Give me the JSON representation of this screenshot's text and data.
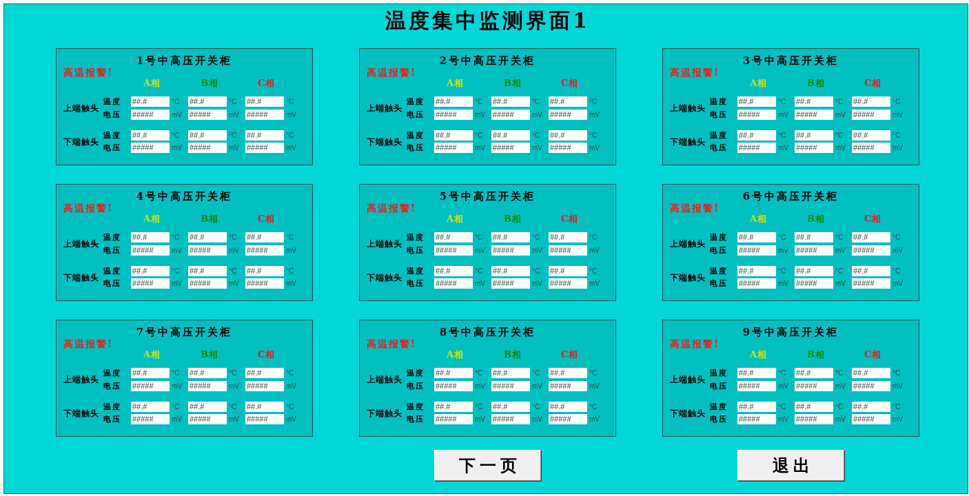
{
  "title": "温度集中监测界面1",
  "cabinets": [
    {
      "name": "1号中高压开关柜",
      "alarm": "高温报警!",
      "phases": [
        {
          "label": "A相",
          "color": "#dede00"
        },
        {
          "label": "B相",
          "color": "#0a8a0a"
        },
        {
          "label": "C相",
          "color": "#e81c1c"
        }
      ],
      "contacts": [
        {
          "label": "上端触头",
          "rows": [
            {
              "label": "温度",
              "cells": [
                {
                  "value": "##.#",
                  "unit": "°C"
                },
                {
                  "value": "##.#",
                  "unit": "°C"
                },
                {
                  "value": "##.#",
                  "unit": "°C"
                }
              ]
            },
            {
              "label": "电压",
              "cells": [
                {
                  "value": "#####",
                  "unit": "mV"
                },
                {
                  "value": "#####",
                  "unit": "mV"
                },
                {
                  "value": "#####",
                  "unit": "mV"
                }
              ]
            }
          ]
        },
        {
          "label": "下端触头",
          "rows": [
            {
              "label": "温度",
              "cells": [
                {
                  "value": "##.#",
                  "unit": "°C"
                },
                {
                  "value": "##.#",
                  "unit": "°C"
                },
                {
                  "value": "##.#",
                  "unit": "°C"
                }
              ]
            },
            {
              "label": "电压",
              "cells": [
                {
                  "value": "#####",
                  "unit": "mV"
                },
                {
                  "value": "#####",
                  "unit": "mV"
                },
                {
                  "value": "#####",
                  "unit": "mV"
                }
              ]
            }
          ]
        }
      ]
    },
    {
      "name": "2号中高压开关柜",
      "alarm": "高温报警!",
      "phases": [
        {
          "label": "A相",
          "color": "#dede00"
        },
        {
          "label": "B相",
          "color": "#0a8a0a"
        },
        {
          "label": "C相",
          "color": "#e81c1c"
        }
      ],
      "contacts": [
        {
          "label": "上端触头",
          "rows": [
            {
              "label": "温度",
              "cells": [
                {
                  "value": "##.#",
                  "unit": "°C"
                },
                {
                  "value": "##.#",
                  "unit": "°C"
                },
                {
                  "value": "##.#",
                  "unit": "°C"
                }
              ]
            },
            {
              "label": "电压",
              "cells": [
                {
                  "value": "#####",
                  "unit": "mV"
                },
                {
                  "value": "#####",
                  "unit": "mV"
                },
                {
                  "value": "#####",
                  "unit": "mV"
                }
              ]
            }
          ]
        },
        {
          "label": "下端触头",
          "rows": [
            {
              "label": "温度",
              "cells": [
                {
                  "value": "##.#",
                  "unit": "°C"
                },
                {
                  "value": "##.#",
                  "unit": "°C"
                },
                {
                  "value": "##.#",
                  "unit": "°C"
                }
              ]
            },
            {
              "label": "电压",
              "cells": [
                {
                  "value": "#####",
                  "unit": "mV"
                },
                {
                  "value": "#####",
                  "unit": "mV"
                },
                {
                  "value": "#####",
                  "unit": "mV"
                }
              ]
            }
          ]
        }
      ]
    },
    {
      "name": "3号中高压开关柜",
      "alarm": "高温报警!",
      "phases": [
        {
          "label": "A相",
          "color": "#dede00"
        },
        {
          "label": "B相",
          "color": "#0a8a0a"
        },
        {
          "label": "C相",
          "color": "#e81c1c"
        }
      ],
      "contacts": [
        {
          "label": "上端触头",
          "rows": [
            {
              "label": "温度",
              "cells": [
                {
                  "value": "##.#",
                  "unit": "°C"
                },
                {
                  "value": "##.#",
                  "unit": "°C"
                },
                {
                  "value": "##.#",
                  "unit": "°C"
                }
              ]
            },
            {
              "label": "电压",
              "cells": [
                {
                  "value": "#####",
                  "unit": "mV"
                },
                {
                  "value": "#####",
                  "unit": "mV"
                },
                {
                  "value": "#####",
                  "unit": "mV"
                }
              ]
            }
          ]
        },
        {
          "label": "下端触头",
          "rows": [
            {
              "label": "温度",
              "cells": [
                {
                  "value": "##.#",
                  "unit": "°C"
                },
                {
                  "value": "##.#",
                  "unit": "°C"
                },
                {
                  "value": "##.#",
                  "unit": "°C"
                }
              ]
            },
            {
              "label": "电压",
              "cells": [
                {
                  "value": "#####",
                  "unit": "mV"
                },
                {
                  "value": "#####",
                  "unit": "mV"
                },
                {
                  "value": "#####",
                  "unit": "mV"
                }
              ]
            }
          ]
        }
      ]
    },
    {
      "name": "4号中高压开关柜",
      "alarm": "高温报警!",
      "phases": [
        {
          "label": "A相",
          "color": "#dede00"
        },
        {
          "label": "B相",
          "color": "#0a8a0a"
        },
        {
          "label": "C相",
          "color": "#e81c1c"
        }
      ],
      "contacts": [
        {
          "label": "上端触头",
          "rows": [
            {
              "label": "温度",
              "cells": [
                {
                  "value": "##.#",
                  "unit": "°C"
                },
                {
                  "value": "##.#",
                  "unit": "°C"
                },
                {
                  "value": "##.#",
                  "unit": "°C"
                }
              ]
            },
            {
              "label": "电压",
              "cells": [
                {
                  "value": "#####",
                  "unit": "mV"
                },
                {
                  "value": "#####",
                  "unit": "mV"
                },
                {
                  "value": "#####",
                  "unit": "mV"
                }
              ]
            }
          ]
        },
        {
          "label": "下端触头",
          "rows": [
            {
              "label": "温度",
              "cells": [
                {
                  "value": "##.#",
                  "unit": "°C"
                },
                {
                  "value": "##.#",
                  "unit": "°C"
                },
                {
                  "value": "##.#",
                  "unit": "°C"
                }
              ]
            },
            {
              "label": "电压",
              "cells": [
                {
                  "value": "#####",
                  "unit": "mV"
                },
                {
                  "value": "#####",
                  "unit": "mV"
                },
                {
                  "value": "#####",
                  "unit": "mV"
                }
              ]
            }
          ]
        }
      ]
    },
    {
      "name": "5号中高压开关柜",
      "alarm": "高温报警!",
      "phases": [
        {
          "label": "A相",
          "color": "#dede00"
        },
        {
          "label": "B相",
          "color": "#0a8a0a"
        },
        {
          "label": "C相",
          "color": "#e81c1c"
        }
      ],
      "contacts": [
        {
          "label": "上端触头",
          "rows": [
            {
              "label": "温度",
              "cells": [
                {
                  "value": "##.#",
                  "unit": "°C"
                },
                {
                  "value": "##.#",
                  "unit": "°C"
                },
                {
                  "value": "##.#",
                  "unit": "°C"
                }
              ]
            },
            {
              "label": "电压",
              "cells": [
                {
                  "value": "#####",
                  "unit": "mV"
                },
                {
                  "value": "#####",
                  "unit": "mV"
                },
                {
                  "value": "#####",
                  "unit": "mV"
                }
              ]
            }
          ]
        },
        {
          "label": "下端触头",
          "rows": [
            {
              "label": "温度",
              "cells": [
                {
                  "value": "##.#",
                  "unit": "°C"
                },
                {
                  "value": "##.#",
                  "unit": "°C"
                },
                {
                  "value": "##.#",
                  "unit": "°C"
                }
              ]
            },
            {
              "label": "电压",
              "cells": [
                {
                  "value": "#####",
                  "unit": "mV"
                },
                {
                  "value": "#####",
                  "unit": "mV"
                },
                {
                  "value": "#####",
                  "unit": "mV"
                }
              ]
            }
          ]
        }
      ]
    },
    {
      "name": "6号中高压开关柜",
      "alarm": "高温报警!",
      "phases": [
        {
          "label": "A相",
          "color": "#dede00"
        },
        {
          "label": "B相",
          "color": "#0a8a0a"
        },
        {
          "label": "C相",
          "color": "#e81c1c"
        }
      ],
      "contacts": [
        {
          "label": "上端触头",
          "rows": [
            {
              "label": "温度",
              "cells": [
                {
                  "value": "##.#",
                  "unit": "°C"
                },
                {
                  "value": "##.#",
                  "unit": "°C"
                },
                {
                  "value": "##.#",
                  "unit": "°C"
                }
              ]
            },
            {
              "label": "电压",
              "cells": [
                {
                  "value": "#####",
                  "unit": "mV"
                },
                {
                  "value": "#####",
                  "unit": "mV"
                },
                {
                  "value": "#####",
                  "unit": "mV"
                }
              ]
            }
          ]
        },
        {
          "label": "下端触头",
          "rows": [
            {
              "label": "温度",
              "cells": [
                {
                  "value": "##.#",
                  "unit": "°C"
                },
                {
                  "value": "##.#",
                  "unit": "°C"
                },
                {
                  "value": "##.#",
                  "unit": "°C"
                }
              ]
            },
            {
              "label": "电压",
              "cells": [
                {
                  "value": "#####",
                  "unit": "mV"
                },
                {
                  "value": "#####",
                  "unit": "mV"
                },
                {
                  "value": "#####",
                  "unit": "mV"
                }
              ]
            }
          ]
        }
      ]
    },
    {
      "name": "7号中高压开关柜",
      "alarm": "高温报警!",
      "phases": [
        {
          "label": "A相",
          "color": "#dede00"
        },
        {
          "label": "B相",
          "color": "#0a8a0a"
        },
        {
          "label": "C相",
          "color": "#e81c1c"
        }
      ],
      "contacts": [
        {
          "label": "上端触头",
          "rows": [
            {
              "label": "温度",
              "cells": [
                {
                  "value": "##.#",
                  "unit": "°C"
                },
                {
                  "value": "##.#",
                  "unit": "°C"
                },
                {
                  "value": "##.#",
                  "unit": "°C"
                }
              ]
            },
            {
              "label": "电压",
              "cells": [
                {
                  "value": "#####",
                  "unit": "mV"
                },
                {
                  "value": "#####",
                  "unit": "mV"
                },
                {
                  "value": "#####",
                  "unit": "mV"
                }
              ]
            }
          ]
        },
        {
          "label": "下端触头",
          "rows": [
            {
              "label": "温度",
              "cells": [
                {
                  "value": "##.#",
                  "unit": "°C"
                },
                {
                  "value": "##.#",
                  "unit": "°C"
                },
                {
                  "value": "##.#",
                  "unit": "°C"
                }
              ]
            },
            {
              "label": "电压",
              "cells": [
                {
                  "value": "#####",
                  "unit": "mV"
                },
                {
                  "value": "#####",
                  "unit": "mV"
                },
                {
                  "value": "#####",
                  "unit": "mV"
                }
              ]
            }
          ]
        }
      ]
    },
    {
      "name": "8号中高压开关柜",
      "alarm": "高温报警!",
      "phases": [
        {
          "label": "A相",
          "color": "#dede00"
        },
        {
          "label": "B相",
          "color": "#0a8a0a"
        },
        {
          "label": "C相",
          "color": "#e81c1c"
        }
      ],
      "contacts": [
        {
          "label": "上端触头",
          "rows": [
            {
              "label": "温度",
              "cells": [
                {
                  "value": "##.#",
                  "unit": "°C"
                },
                {
                  "value": "##.#",
                  "unit": "°C"
                },
                {
                  "value": "##.#",
                  "unit": "°C"
                }
              ]
            },
            {
              "label": "电压",
              "cells": [
                {
                  "value": "#####",
                  "unit": "mV"
                },
                {
                  "value": "#####",
                  "unit": "mV"
                },
                {
                  "value": "#####",
                  "unit": "mV"
                }
              ]
            }
          ]
        },
        {
          "label": "下端触头",
          "rows": [
            {
              "label": "温度",
              "cells": [
                {
                  "value": "##.#",
                  "unit": "°C"
                },
                {
                  "value": "##.#",
                  "unit": "°C"
                },
                {
                  "value": "##.#",
                  "unit": "°C"
                }
              ]
            },
            {
              "label": "电压",
              "cells": [
                {
                  "value": "#####",
                  "unit": "mV"
                },
                {
                  "value": "#####",
                  "unit": "mV"
                },
                {
                  "value": "#####",
                  "unit": "mV"
                }
              ]
            }
          ]
        }
      ]
    },
    {
      "name": "9号中高压开关柜",
      "alarm": "高温报警!",
      "phases": [
        {
          "label": "A相",
          "color": "#dede00"
        },
        {
          "label": "B相",
          "color": "#0a8a0a"
        },
        {
          "label": "C相",
          "color": "#e81c1c"
        }
      ],
      "contacts": [
        {
          "label": "上端触头",
          "rows": [
            {
              "label": "温度",
              "cells": [
                {
                  "value": "##.#",
                  "unit": "°C"
                },
                {
                  "value": "##.#",
                  "unit": "°C"
                },
                {
                  "value": "##.#",
                  "unit": "°C"
                }
              ]
            },
            {
              "label": "电压",
              "cells": [
                {
                  "value": "#####",
                  "unit": "mV"
                },
                {
                  "value": "#####",
                  "unit": "mV"
                },
                {
                  "value": "#####",
                  "unit": "mV"
                }
              ]
            }
          ]
        },
        {
          "label": "下端触头",
          "rows": [
            {
              "label": "温度",
              "cells": [
                {
                  "value": "##.#",
                  "unit": "°C"
                },
                {
                  "value": "##.#",
                  "unit": "°C"
                },
                {
                  "value": "##.#",
                  "unit": "°C"
                }
              ]
            },
            {
              "label": "电压",
              "cells": [
                {
                  "value": "#####",
                  "unit": "mV"
                },
                {
                  "value": "#####",
                  "unit": "mV"
                },
                {
                  "value": "#####",
                  "unit": "mV"
                }
              ]
            }
          ]
        }
      ]
    }
  ],
  "buttons": [
    {
      "label": "下一页"
    },
    {
      "label": "退出"
    }
  ]
}
